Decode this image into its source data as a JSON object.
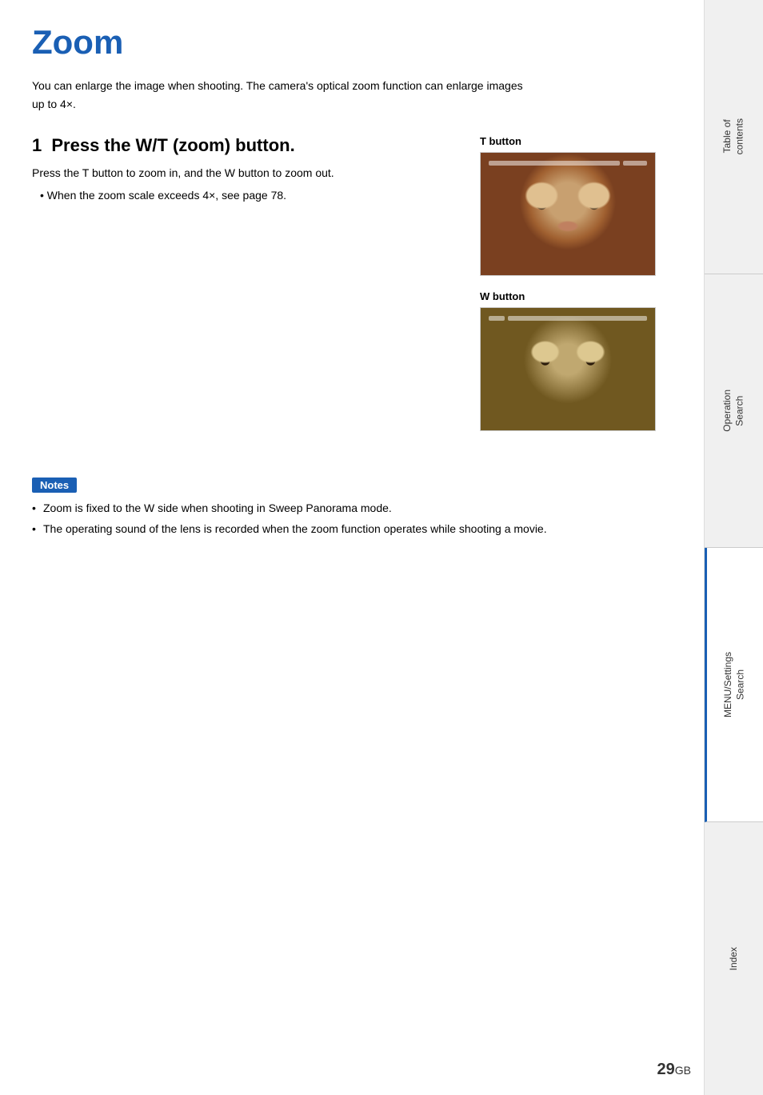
{
  "page": {
    "title": "Zoom",
    "intro": "You can enlarge the image when shooting. The camera's optical zoom function can enlarge images up to 4×.",
    "step1": {
      "number": "1",
      "heading": "Press the W/T (zoom) button.",
      "body": "Press the T button to zoom in, and the W button to zoom out.",
      "bullets": [
        "When the zoom scale exceeds 4×, see page 78."
      ]
    },
    "t_button_label": "T button",
    "w_button_label": "W button",
    "notes": {
      "label": "Notes",
      "items": [
        "Zoom is fixed to the W side when shooting in Sweep Panorama mode.",
        "The operating sound of the lens is recorded when the zoom function operates while shooting a movie."
      ]
    },
    "page_number": "29",
    "page_suffix": "GB"
  },
  "sidebar": {
    "tabs": [
      {
        "label": "Table of\ncontents",
        "active": false
      },
      {
        "label": "Operation\nSearch",
        "active": false
      },
      {
        "label": "MENU/Settings\nSearch",
        "active": true
      },
      {
        "label": "Index",
        "active": false
      }
    ]
  }
}
